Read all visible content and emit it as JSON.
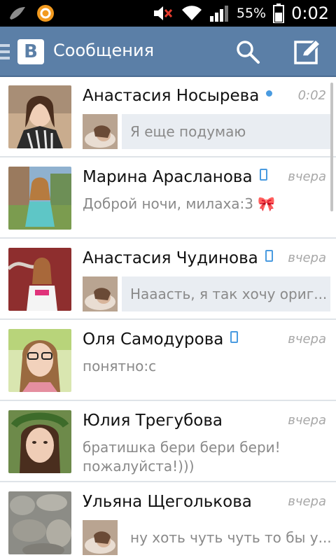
{
  "status_bar": {
    "battery_percent": "55%",
    "time": "0:02",
    "icons": [
      "bird-icon",
      "circle-app-icon",
      "mute-icon",
      "wifi-icon",
      "signal-icon",
      "battery-icon"
    ]
  },
  "header": {
    "logo": "B",
    "title": "Сообщения",
    "search_icon": "search-icon",
    "compose_icon": "compose-icon"
  },
  "colors": {
    "header_bg": "#5b7fa7",
    "online_indicator": "#4a9be0",
    "bubble_bg": "#e9edf2"
  },
  "conversations": [
    {
      "name": "Анастасия Носырева",
      "time": "0:02",
      "status": "online",
      "preview": "Я еще подумаю",
      "outgoing": true
    },
    {
      "name": "Марина Арасланова",
      "time": "вчера",
      "status": "mobile",
      "preview": "Доброй ночи, милаха:3 🎀",
      "outgoing": false
    },
    {
      "name": "Анастасия Чудинова",
      "time": "вчера",
      "status": "mobile",
      "preview": "Нааасть, я так хочу ориг...",
      "outgoing": true
    },
    {
      "name": "Оля Самодурова",
      "time": "вчера",
      "status": "mobile",
      "preview": "понятно:с",
      "outgoing": false
    },
    {
      "name": "Юлия Трегубова",
      "time": "вчера",
      "status": "none",
      "preview": "братишка бери бери бери! пожалуйста!)))",
      "outgoing": false
    },
    {
      "name": "Ульяна Щеголькова",
      "time": "вчера",
      "status": "none",
      "preview": "ну хоть чуть чуть то бы у...",
      "outgoing": true
    }
  ]
}
